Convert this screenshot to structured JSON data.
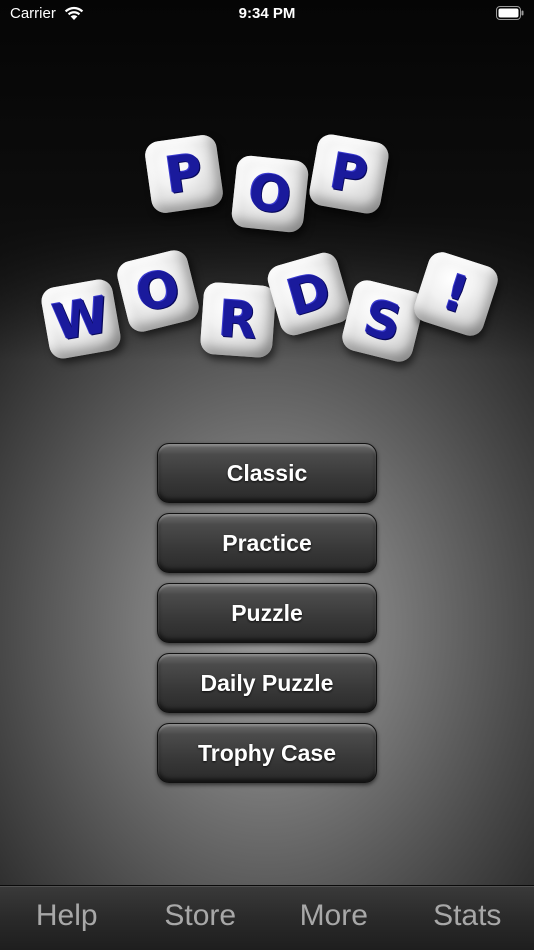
{
  "status_bar": {
    "carrier": "Carrier",
    "time": "9:34 PM",
    "wifi_icon": "wifi-icon",
    "battery_icon": "battery-icon"
  },
  "logo": {
    "line1": [
      "P",
      "O",
      "P"
    ],
    "line2": [
      "W",
      "O",
      "R",
      "D",
      "S",
      "!"
    ],
    "letter_color": "#1a1a9c"
  },
  "menu": {
    "buttons": [
      {
        "label": "Classic"
      },
      {
        "label": "Practice"
      },
      {
        "label": "Puzzle"
      },
      {
        "label": "Daily Puzzle"
      },
      {
        "label": "Trophy Case"
      }
    ]
  },
  "tab_bar": {
    "items": [
      {
        "label": "Help"
      },
      {
        "label": "Store"
      },
      {
        "label": "More"
      },
      {
        "label": "Stats"
      }
    ]
  }
}
